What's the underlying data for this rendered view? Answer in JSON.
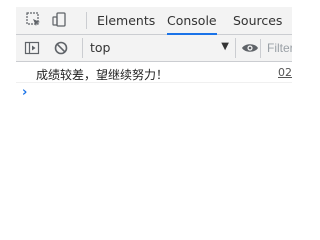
{
  "tabs": [
    {
      "label": "Elements",
      "active": false
    },
    {
      "label": "Console",
      "active": true
    },
    {
      "label": "Sources",
      "active": false
    }
  ],
  "toolbar": {
    "context": "top",
    "filter_placeholder": "Filter"
  },
  "console": {
    "messages": [
      {
        "text": "成绩较差，望继续努力！",
        "source": "02"
      }
    ]
  },
  "colors": {
    "accent": "#1a73e8",
    "toolbar_bg": "#f3f3f3",
    "border": "#cbcdd1"
  }
}
